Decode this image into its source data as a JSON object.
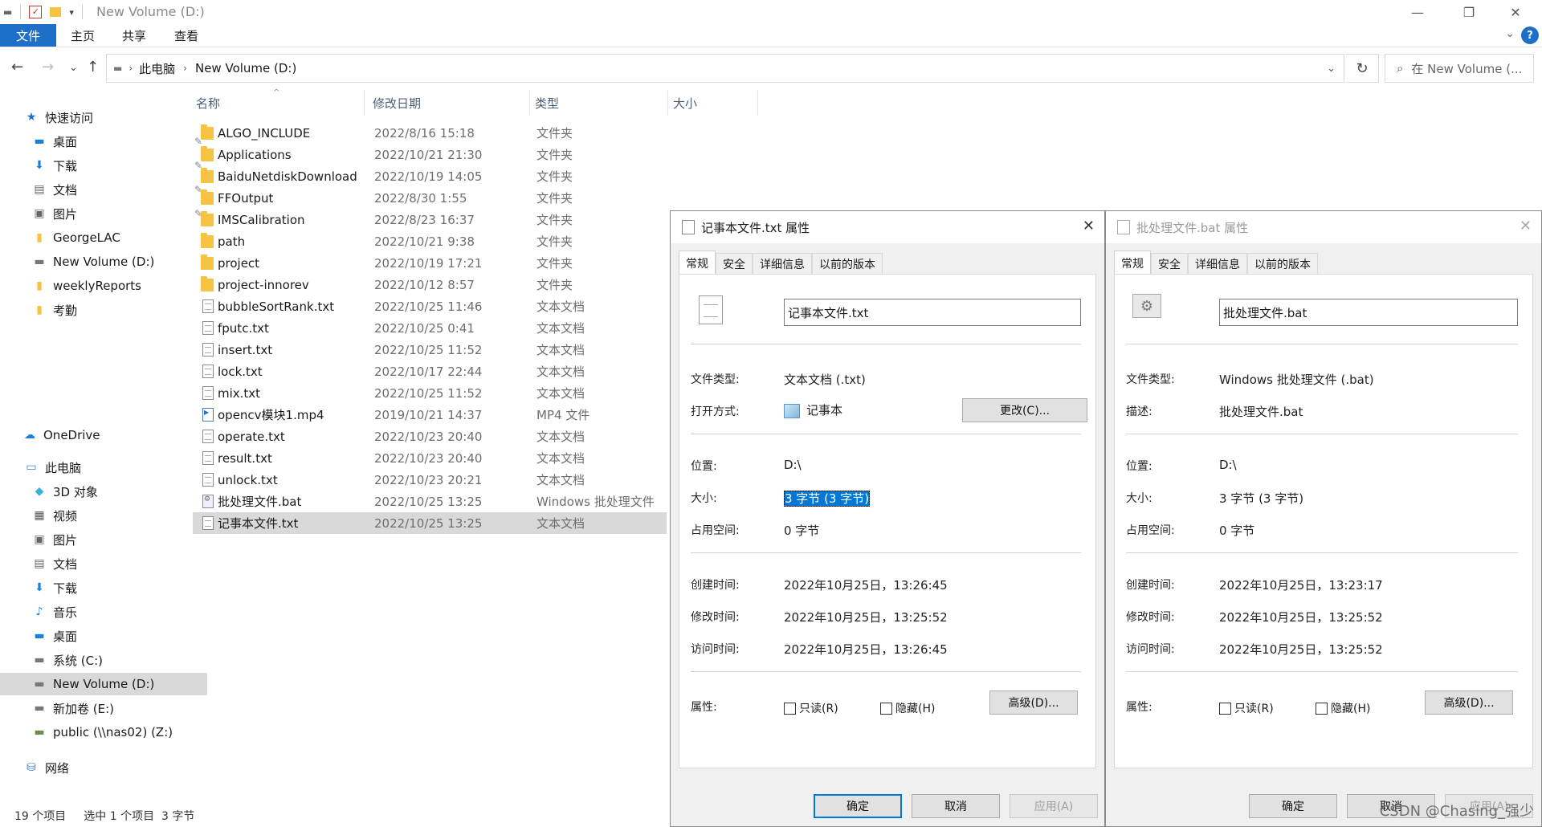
{
  "window": {
    "title": "New Volume (D:)"
  },
  "ribbon": {
    "file_tab": "文件",
    "tabs": [
      "主页",
      "共享",
      "查看"
    ]
  },
  "address": {
    "segments": [
      "此电脑",
      "New Volume (D:)"
    ],
    "search_placeholder": "在 New Volume (..."
  },
  "sidebar": {
    "quick_access": "快速访问",
    "items": [
      {
        "label": "桌面",
        "icon": "desktop-icon",
        "pinned": true
      },
      {
        "label": "下载",
        "icon": "download-icon",
        "pinned": true
      },
      {
        "label": "文档",
        "icon": "documents-icon",
        "pinned": true
      },
      {
        "label": "图片",
        "icon": "pictures-icon",
        "pinned": true
      },
      {
        "label": "GeorgeLAC",
        "icon": "folder-icon"
      },
      {
        "label": "New Volume (D:)",
        "icon": "drive-icon"
      },
      {
        "label": "weeklyReports",
        "icon": "folder-icon"
      },
      {
        "label": "考勤",
        "icon": "folder-icon"
      }
    ],
    "onedrive": "OneDrive",
    "this_pc": "此电脑",
    "pc_items": [
      {
        "label": "3D 对象",
        "icon": "3d-objects-icon"
      },
      {
        "label": "视频",
        "icon": "video-icon"
      },
      {
        "label": "图片",
        "icon": "pictures-icon"
      },
      {
        "label": "文档",
        "icon": "documents-icon"
      },
      {
        "label": "下载",
        "icon": "download-icon"
      },
      {
        "label": "音乐",
        "icon": "music-icon"
      },
      {
        "label": "桌面",
        "icon": "desktop-icon"
      },
      {
        "label": "系统 (C:)",
        "icon": "drive-icon"
      },
      {
        "label": "New Volume (D:)",
        "icon": "drive-icon",
        "active": true
      },
      {
        "label": "新加卷 (E:)",
        "icon": "drive-icon"
      },
      {
        "label": "public (\\\\nas02) (Z:)",
        "icon": "network-drive-icon"
      }
    ],
    "network": "网络"
  },
  "columns": [
    "名称",
    "修改日期",
    "类型",
    "大小"
  ],
  "files": [
    {
      "name": "ALGO_INCLUDE",
      "date": "2022/8/16 15:18",
      "type": "文件夹",
      "kind": "folder"
    },
    {
      "name": "Applications",
      "date": "2022/10/21 21:30",
      "type": "文件夹",
      "kind": "folder"
    },
    {
      "name": "BaiduNetdiskDownload",
      "date": "2022/10/19 14:05",
      "type": "文件夹",
      "kind": "folder"
    },
    {
      "name": "FFOutput",
      "date": "2022/8/30 1:55",
      "type": "文件夹",
      "kind": "folder"
    },
    {
      "name": "IMSCalibration",
      "date": "2022/8/23 16:37",
      "type": "文件夹",
      "kind": "folder"
    },
    {
      "name": "path",
      "date": "2022/10/21 9:38",
      "type": "文件夹",
      "kind": "folder"
    },
    {
      "name": "project",
      "date": "2022/10/19 17:21",
      "type": "文件夹",
      "kind": "folder"
    },
    {
      "name": "project-innorev",
      "date": "2022/10/12 8:57",
      "type": "文件夹",
      "kind": "folder"
    },
    {
      "name": "bubbleSortRank.txt",
      "date": "2022/10/25 11:46",
      "type": "文本文档",
      "kind": "doc"
    },
    {
      "name": "fputc.txt",
      "date": "2022/10/25 0:41",
      "type": "文本文档",
      "kind": "doc"
    },
    {
      "name": "insert.txt",
      "date": "2022/10/25 11:52",
      "type": "文本文档",
      "kind": "doc"
    },
    {
      "name": "lock.txt",
      "date": "2022/10/17 22:44",
      "type": "文本文档",
      "kind": "doc"
    },
    {
      "name": "mix.txt",
      "date": "2022/10/25 11:52",
      "type": "文本文档",
      "kind": "doc"
    },
    {
      "name": "opencv模块1.mp4",
      "date": "2019/10/21 14:37",
      "type": "MP4 文件",
      "kind": "vid"
    },
    {
      "name": "operate.txt",
      "date": "2022/10/23 20:40",
      "type": "文本文档",
      "kind": "doc"
    },
    {
      "name": "result.txt",
      "date": "2022/10/23 20:40",
      "type": "文本文档",
      "kind": "doc"
    },
    {
      "name": "unlock.txt",
      "date": "2022/10/23 20:21",
      "type": "文本文档",
      "kind": "doc"
    },
    {
      "name": "批处理文件.bat",
      "date": "2022/10/25 13:25",
      "type": "Windows 批处理文件",
      "kind": "bat"
    },
    {
      "name": "记事本文件.txt",
      "date": "2022/10/25 13:25",
      "type": "文本文档",
      "kind": "doc",
      "selected": true
    }
  ],
  "status": {
    "count": "19 个项目",
    "selection": "选中 1 个项目  3 字节"
  },
  "dialog_txt": {
    "title": "记事本文件.txt 属性",
    "tabs": [
      "常规",
      "安全",
      "详细信息",
      "以前的版本"
    ],
    "filename": "记事本文件.txt",
    "type_label": "文件类型:",
    "type_value": "文本文档 (.txt)",
    "open_label": "打开方式:",
    "open_value": "记事本",
    "change_button": "更改(C)...",
    "location_label": "位置:",
    "location_value": "D:\\",
    "size_label": "大小:",
    "size_value": "3 字节 (3 字节)",
    "disk_label": "占用空间:",
    "disk_value": "0 字节",
    "created_label": "创建时间:",
    "created_value": "2022年10月25日，13:26:45",
    "modified_label": "修改时间:",
    "modified_value": "2022年10月25日，13:25:52",
    "accessed_label": "访问时间:",
    "accessed_value": "2022年10月25日，13:26:45",
    "attr_label": "属性:",
    "readonly": "只读(R)",
    "hidden": "隐藏(H)",
    "advanced": "高级(D)...",
    "ok": "确定",
    "cancel": "取消",
    "apply": "应用(A)"
  },
  "dialog_bat": {
    "title": "批处理文件.bat 属性",
    "tabs": [
      "常规",
      "安全",
      "详细信息",
      "以前的版本"
    ],
    "filename": "批处理文件.bat",
    "type_label": "文件类型:",
    "type_value": "Windows 批处理文件 (.bat)",
    "desc_label": "描述:",
    "desc_value": "批处理文件.bat",
    "location_label": "位置:",
    "location_value": "D:\\",
    "size_label": "大小:",
    "size_value": "3 字节 (3 字节)",
    "disk_label": "占用空间:",
    "disk_value": "0 字节",
    "created_label": "创建时间:",
    "created_value": "2022年10月25日，13:23:17",
    "modified_label": "修改时间:",
    "modified_value": "2022年10月25日，13:25:52",
    "accessed_label": "访问时间:",
    "accessed_value": "2022年10月25日，13:25:52",
    "attr_label": "属性:",
    "readonly": "只读(R)",
    "hidden": "隐藏(H)",
    "advanced": "高级(D)...",
    "ok": "确定",
    "cancel": "取消",
    "apply": "应用(A)"
  },
  "watermark": "CSDN @Chasing_强少"
}
